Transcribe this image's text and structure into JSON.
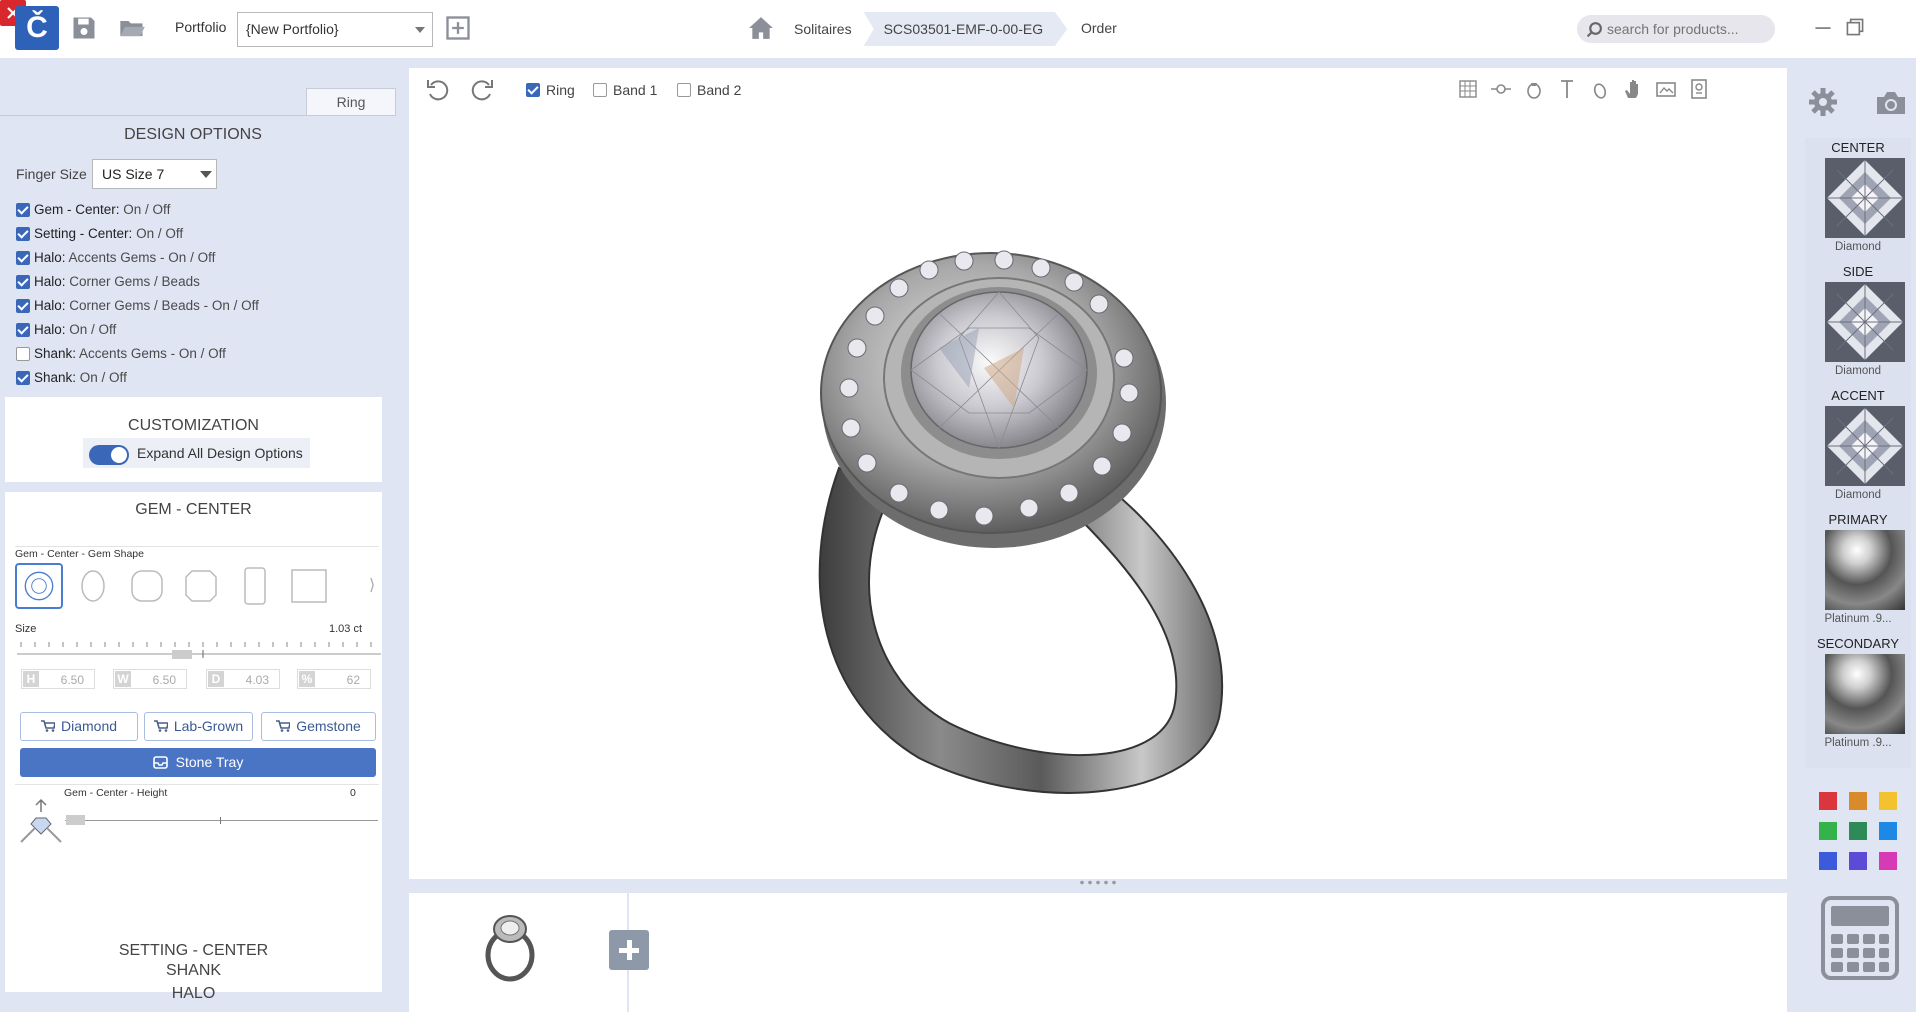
{
  "topbar": {
    "logo_text": "Č",
    "portfolio_label": "Portfolio",
    "portfolio_value": "{New Portfolio}",
    "breadcrumb": [
      "Solitaires",
      "SCS03501-EMF-0-00-EG"
    ],
    "order_label": "Order",
    "search_placeholder": "search for products..."
  },
  "left_panel": {
    "tab_label": "Ring",
    "design_options_title": "DESIGN OPTIONS",
    "finger_size_label": "Finger Size",
    "finger_size_value": "US Size 7",
    "options": [
      {
        "prefix": "Gem - Center:",
        "suffix": "On / Off",
        "checked": true
      },
      {
        "prefix": "Setting - Center:",
        "suffix": "On / Off",
        "checked": true
      },
      {
        "prefix": "Halo:",
        "suffix": "Accents Gems - On / Off",
        "checked": true
      },
      {
        "prefix": "Halo:",
        "suffix": "Corner Gems / Beads",
        "checked": true
      },
      {
        "prefix": "Halo:",
        "suffix": "Corner Gems / Beads - On / Off",
        "checked": true
      },
      {
        "prefix": "Halo:",
        "suffix": "On / Off",
        "checked": true
      },
      {
        "prefix": "Shank:",
        "suffix": "Accents Gems - On / Off",
        "checked": false
      },
      {
        "prefix": "Shank:",
        "suffix": "On / Off",
        "checked": true
      }
    ],
    "customization_title": "CUSTOMIZATION",
    "expand_label": "Expand All Design Options",
    "expand_on": true,
    "gem_center_title": "GEM - CENTER",
    "gem_shape_label": "Gem - Center - Gem Shape",
    "size_label": "Size",
    "size_value": "1.03 ct",
    "dims": [
      {
        "letter": "H",
        "value": "6.50"
      },
      {
        "letter": "W",
        "value": "6.50"
      },
      {
        "letter": "D",
        "value": "4.03"
      },
      {
        "letter": "%",
        "value": "62"
      }
    ],
    "shop_buttons": [
      "Diamond",
      "Lab-Grown",
      "Gemstone"
    ],
    "stone_tray_label": "Stone Tray",
    "height_label": "Gem - Center - Height",
    "height_value": "0",
    "sections": [
      "SETTING - CENTER",
      "HALO",
      "SHANK"
    ]
  },
  "viewer": {
    "checkboxes": [
      {
        "label": "Ring",
        "checked": true
      },
      {
        "label": "Band 1",
        "checked": false
      },
      {
        "label": "Band 2",
        "checked": false
      }
    ]
  },
  "right_panel": {
    "materials": [
      {
        "heading": "CENTER",
        "name": "Diamond"
      },
      {
        "heading": "SIDE",
        "name": "Diamond"
      },
      {
        "heading": "ACCENT",
        "name": "Diamond"
      },
      {
        "heading": "PRIMARY",
        "name": "Platinum .9..."
      },
      {
        "heading": "SECONDARY",
        "name": "Platinum .9..."
      }
    ],
    "colors": [
      "#d9363e",
      "#d98b2b",
      "#f2c230",
      "#33b34a",
      "#2e8b57",
      "#1e88e5",
      "#3b5bdb",
      "#5b4bd6",
      "#d63bb5"
    ]
  },
  "colors": {
    "accent": "#3b67b8",
    "close_button": "#d8282e",
    "panel_bg": "#dfe5f3"
  }
}
